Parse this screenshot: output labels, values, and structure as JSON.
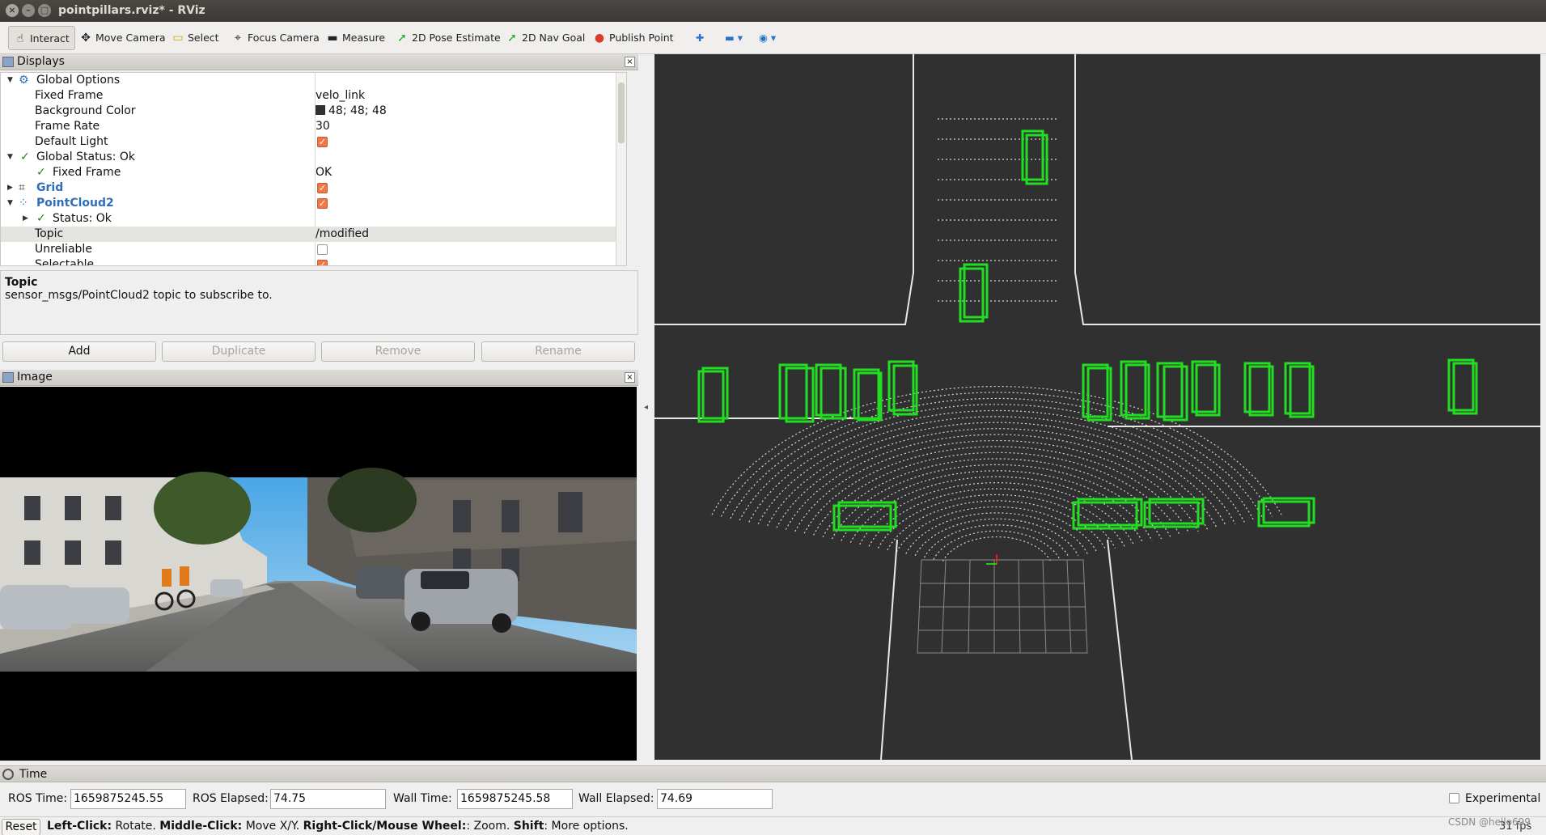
{
  "window": {
    "title": "pointpillars.rviz* - RViz"
  },
  "toolbar": {
    "tools": [
      {
        "label": "Interact",
        "icon": "hand-pointer-icon"
      },
      {
        "label": "Move Camera",
        "icon": "move-arrows-icon"
      },
      {
        "label": "Select",
        "icon": "select-box-icon"
      },
      {
        "label": "Focus Camera",
        "icon": "focus-target-icon"
      },
      {
        "label": "Measure",
        "icon": "ruler-icon"
      },
      {
        "label": "2D Pose Estimate",
        "icon": "green-arrow-icon"
      },
      {
        "label": "2D Nav Goal",
        "icon": "green-arrow-icon"
      },
      {
        "label": "Publish Point",
        "icon": "map-pin-icon"
      }
    ]
  },
  "displays": {
    "title": "Displays",
    "rows": [
      {
        "label": "Global Options",
        "value": ""
      },
      {
        "label": "Fixed Frame",
        "value": "velo_link"
      },
      {
        "label": "Background Color",
        "value": "48; 48; 48"
      },
      {
        "label": "Frame Rate",
        "value": "30"
      },
      {
        "label": "Default Light",
        "checked": true
      },
      {
        "label": "Global Status: Ok",
        "value": ""
      },
      {
        "label": "Fixed Frame",
        "value": "OK"
      },
      {
        "label": "Grid",
        "checked": true
      },
      {
        "label": "PointCloud2",
        "checked": true
      },
      {
        "label": "Status: Ok",
        "value": ""
      },
      {
        "label": "Topic",
        "value": "/modified"
      },
      {
        "label": "Unreliable",
        "checked": false
      },
      {
        "label": "Selectable",
        "checked": true
      }
    ],
    "description": {
      "title": "Topic",
      "text": "sensor_msgs/PointCloud2 topic to subscribe to."
    },
    "buttons": {
      "add": "Add",
      "duplicate": "Duplicate",
      "remove": "Remove",
      "rename": "Rename"
    }
  },
  "image_panel": {
    "title": "Image"
  },
  "time_panel": {
    "title": "Time",
    "ros_time_label": "ROS Time:",
    "ros_time": "1659875245.55",
    "ros_elapsed_label": "ROS Elapsed:",
    "ros_elapsed": "74.75",
    "wall_time_label": "Wall Time:",
    "wall_time": "1659875245.58",
    "wall_elapsed_label": "Wall Elapsed:",
    "wall_elapsed": "74.69",
    "experimental_label": "Experimental"
  },
  "status_bar": {
    "reset": "Reset",
    "left_click": "Left-Click:",
    "left_click_desc": " Rotate. ",
    "middle_click": "Middle-Click:",
    "middle_click_desc": " Move X/Y. ",
    "right_click": "Right-Click/Mouse Wheel:",
    "right_click_desc": ": Zoom. ",
    "shift": "Shift",
    "shift_desc": ": More options.",
    "fps": "31 fps"
  },
  "watermark": "CSDN @hello699",
  "colors": {
    "viewport_bg": "#303030",
    "bbox": "#22dd22",
    "image_bg": "#000000",
    "check_orange": "#f07746"
  }
}
